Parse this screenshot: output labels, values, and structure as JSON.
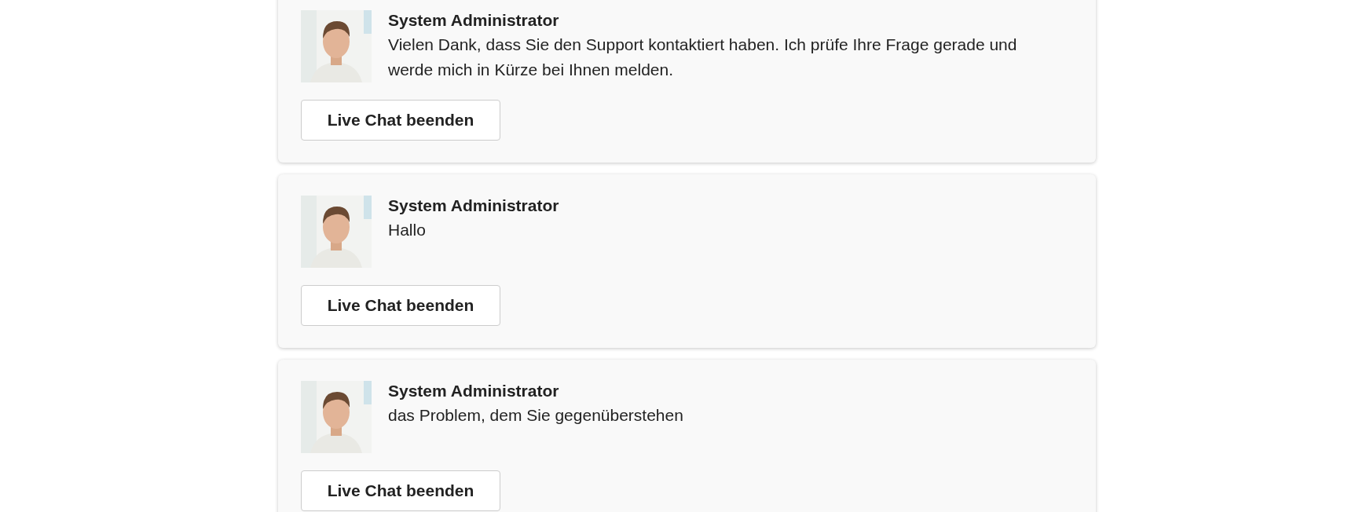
{
  "messages": [
    {
      "sender": "System Administrator",
      "text": "Vielen Dank, dass Sie den Support kontaktiert haben. Ich prüfe Ihre Frage gerade und werde mich in Kürze bei Ihnen melden.",
      "button": "Live Chat beenden"
    },
    {
      "sender": "System Administrator",
      "text": "Hallo",
      "button": "Live Chat beenden"
    },
    {
      "sender": "System Administrator",
      "text": "das Problem, dem Sie gegenüberstehen",
      "button": "Live Chat beenden"
    }
  ]
}
